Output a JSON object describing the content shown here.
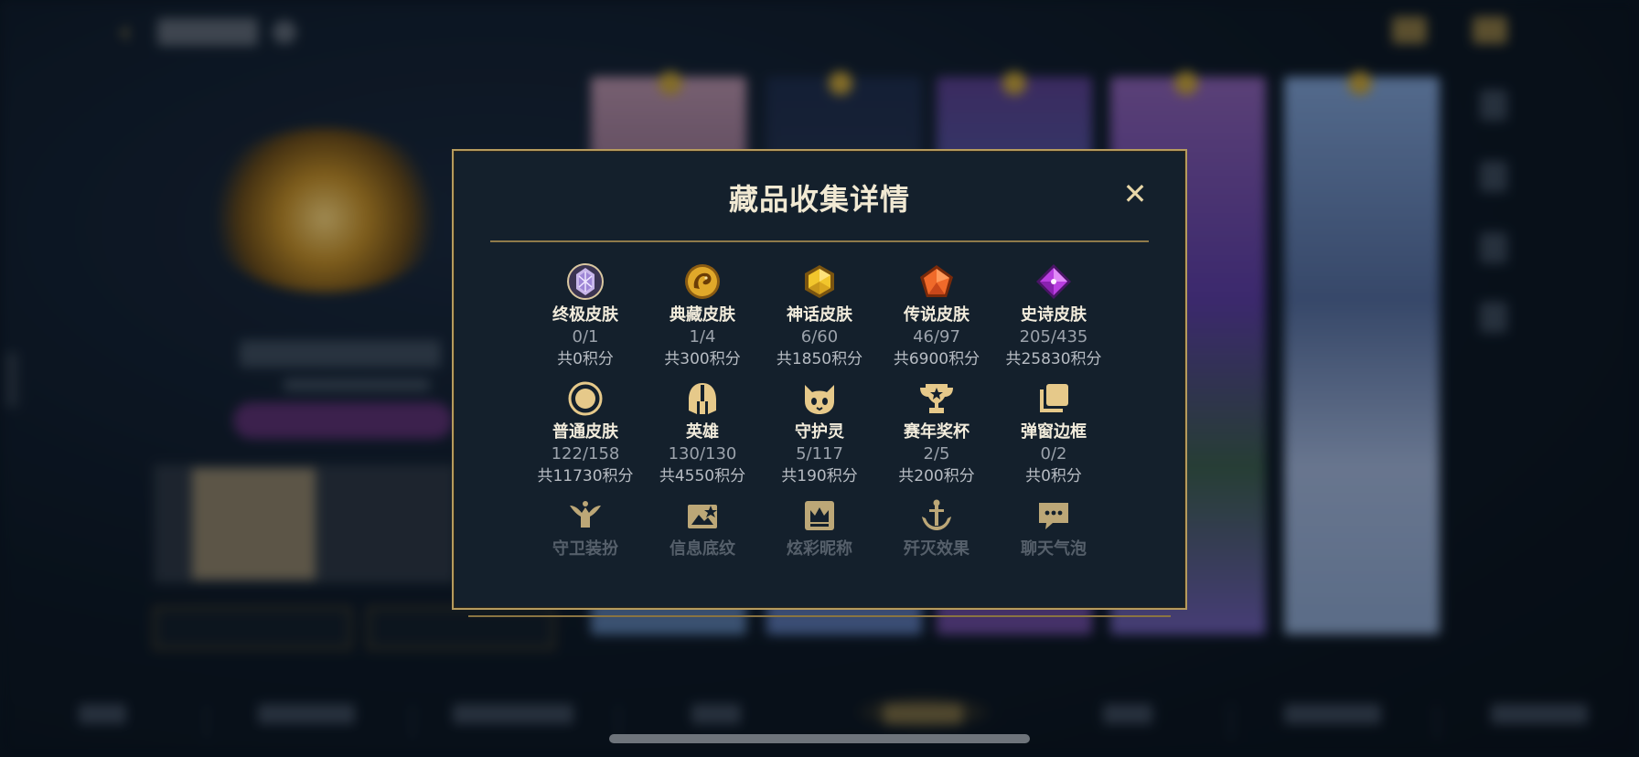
{
  "dialog": {
    "title": "藏品收集详情",
    "close_label": "✕"
  },
  "rows": [
    [
      {
        "name": "终极皮肤",
        "count": "0/1",
        "points": "共0积分",
        "icon": "ultimate-skin-icon"
      },
      {
        "name": "典藏皮肤",
        "count": "1/4",
        "points": "共300积分",
        "icon": "collector-skin-icon"
      },
      {
        "name": "神话皮肤",
        "count": "6/60",
        "points": "共1850积分",
        "icon": "mythic-skin-icon"
      },
      {
        "name": "传说皮肤",
        "count": "46/97",
        "points": "共6900积分",
        "icon": "legendary-skin-icon"
      },
      {
        "name": "史诗皮肤",
        "count": "205/435",
        "points": "共25830积分",
        "icon": "epic-skin-icon"
      }
    ],
    [
      {
        "name": "普通皮肤",
        "count": "122/158",
        "points": "共11730积分",
        "icon": "normal-skin-icon"
      },
      {
        "name": "英雄",
        "count": "130/130",
        "points": "共4550积分",
        "icon": "hero-helmet-icon"
      },
      {
        "name": "守护灵",
        "count": "5/117",
        "points": "共190积分",
        "icon": "guardian-spirit-icon"
      },
      {
        "name": "赛年奖杯",
        "count": "2/5",
        "points": "共200积分",
        "icon": "season-trophy-icon"
      },
      {
        "name": "弹窗边框",
        "count": "0/2",
        "points": "共0积分",
        "icon": "popup-frame-icon"
      }
    ],
    [
      {
        "name": "守卫装扮",
        "icon": "ward-skin-icon"
      },
      {
        "name": "信息底纹",
        "icon": "info-card-icon"
      },
      {
        "name": "炫彩昵称",
        "icon": "nickname-crown-icon"
      },
      {
        "name": "歼灭效果",
        "icon": "ace-effect-icon"
      },
      {
        "name": "聊天气泡",
        "icon": "chat-bubble-icon"
      }
    ]
  ],
  "colors": {
    "gold": "#b59b5e",
    "panel": "#14202c",
    "icon_gold": "#e6c98a"
  }
}
